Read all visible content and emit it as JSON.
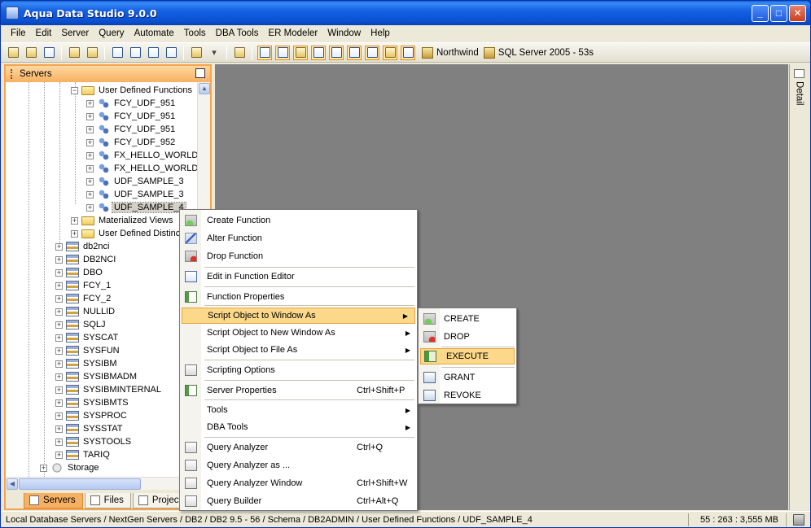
{
  "window": {
    "title": "Aqua Data Studio 9.0.0",
    "minimize": "_",
    "maximize": "□",
    "close": "✕"
  },
  "menubar": [
    "File",
    "Edit",
    "Server",
    "Query",
    "Automate",
    "Tools",
    "DBA Tools",
    "ER Modeler",
    "Window",
    "Help"
  ],
  "toolbar": {
    "connections": [
      "Northwind",
      "SQL Server 2005 - 53s"
    ]
  },
  "servers_panel": {
    "title": "Servers",
    "tree": [
      {
        "label": "User Defined Functions",
        "icon": "folder-icon",
        "expander": "−",
        "indent": 2
      },
      {
        "label": "FCY_UDF_951",
        "icon": "udf-icon",
        "expander": "+",
        "indent": 3
      },
      {
        "label": "FCY_UDF_951",
        "icon": "udf-icon",
        "expander": "+",
        "indent": 3
      },
      {
        "label": "FCY_UDF_951",
        "icon": "udf-icon",
        "expander": "+",
        "indent": 3
      },
      {
        "label": "FCY_UDF_952",
        "icon": "udf-icon",
        "expander": "+",
        "indent": 3
      },
      {
        "label": "FX_HELLO_WORLD_",
        "icon": "udf-icon",
        "expander": "+",
        "indent": 3
      },
      {
        "label": "FX_HELLO_WORLD_",
        "icon": "udf-icon",
        "expander": "+",
        "indent": 3
      },
      {
        "label": "UDF_SAMPLE_3",
        "icon": "udf-icon",
        "expander": "+",
        "indent": 3
      },
      {
        "label": "UDF_SAMPLE_3",
        "icon": "udf-icon",
        "expander": "+",
        "indent": 3
      },
      {
        "label": "UDF_SAMPLE_4",
        "icon": "udf-icon",
        "expander": "+",
        "indent": 3,
        "selected": true
      },
      {
        "label": "Materialized Views",
        "icon": "folder-icon",
        "expander": "+",
        "indent": 2
      },
      {
        "label": "User Defined Distinct Types",
        "icon": "folder-icon",
        "expander": "+",
        "indent": 2
      },
      {
        "label": "db2nci",
        "icon": "schema-icon",
        "expander": "+",
        "indent": 1
      },
      {
        "label": "DB2NCI",
        "icon": "schema-icon",
        "expander": "+",
        "indent": 1
      },
      {
        "label": "DBO",
        "icon": "schema-icon",
        "expander": "+",
        "indent": 1
      },
      {
        "label": "FCY_1",
        "icon": "schema-icon",
        "expander": "+",
        "indent": 1
      },
      {
        "label": "FCY_2",
        "icon": "schema-icon",
        "expander": "+",
        "indent": 1
      },
      {
        "label": "NULLID",
        "icon": "schema-icon",
        "expander": "+",
        "indent": 1
      },
      {
        "label": "SQLJ",
        "icon": "schema-icon",
        "expander": "+",
        "indent": 1
      },
      {
        "label": "SYSCAT",
        "icon": "schema-icon",
        "expander": "+",
        "indent": 1
      },
      {
        "label": "SYSFUN",
        "icon": "schema-icon",
        "expander": "+",
        "indent": 1
      },
      {
        "label": "SYSIBM",
        "icon": "schema-icon",
        "expander": "+",
        "indent": 1
      },
      {
        "label": "SYSIBMADM",
        "icon": "schema-icon",
        "expander": "+",
        "indent": 1
      },
      {
        "label": "SYSIBMINTERNAL",
        "icon": "schema-icon",
        "expander": "+",
        "indent": 1
      },
      {
        "label": "SYSIBMTS",
        "icon": "schema-icon",
        "expander": "+",
        "indent": 1
      },
      {
        "label": "SYSPROC",
        "icon": "schema-icon",
        "expander": "+",
        "indent": 1
      },
      {
        "label": "SYSSTAT",
        "icon": "schema-icon",
        "expander": "+",
        "indent": 1
      },
      {
        "label": "SYSTOOLS",
        "icon": "schema-icon",
        "expander": "+",
        "indent": 1
      },
      {
        "label": "TARIQ",
        "icon": "schema-icon",
        "expander": "+",
        "indent": 1
      },
      {
        "label": "Storage",
        "icon": "storage-icon",
        "expander": "+",
        "indent": 0
      }
    ],
    "tabs": [
      "Servers",
      "Files",
      "Projects"
    ]
  },
  "detail_strip": {
    "label": "Detail"
  },
  "context_menu": {
    "items": [
      {
        "label": "Create Function",
        "shortcut": "",
        "icon": "create-function-icon",
        "submenu": false
      },
      {
        "label": "Alter Function",
        "shortcut": "",
        "icon": "alter-function-icon",
        "submenu": false
      },
      {
        "label": "Drop Function",
        "shortcut": "",
        "icon": "drop-function-icon",
        "submenu": false
      },
      {
        "label": "Edit in Function Editor",
        "shortcut": "",
        "icon": "edit-icon",
        "submenu": false
      },
      {
        "label": "Function Properties",
        "shortcut": "",
        "icon": "properties-icon",
        "submenu": false
      },
      {
        "label": "Script Object to Window As",
        "shortcut": "",
        "icon": "",
        "submenu": true,
        "highlighted": true
      },
      {
        "label": "Script Object to New Window As",
        "shortcut": "",
        "icon": "",
        "submenu": true
      },
      {
        "label": "Script Object to File As",
        "shortcut": "",
        "icon": "",
        "submenu": true
      },
      {
        "label": "Scripting Options",
        "shortcut": "",
        "icon": "scripting-options-icon",
        "submenu": false
      },
      {
        "label": "Server Properties",
        "shortcut": "Ctrl+Shift+P",
        "icon": "server-properties-icon",
        "submenu": false
      },
      {
        "label": "Tools",
        "shortcut": "",
        "icon": "",
        "submenu": true
      },
      {
        "label": "DBA Tools",
        "shortcut": "",
        "icon": "",
        "submenu": true
      },
      {
        "label": "Query Analyzer",
        "shortcut": "Ctrl+Q",
        "icon": "query-analyzer-icon",
        "submenu": false
      },
      {
        "label": "Query Analyzer as ...",
        "shortcut": "",
        "icon": "query-analyzer-as-icon",
        "submenu": false
      },
      {
        "label": "Query Analyzer Window",
        "shortcut": "Ctrl+Shift+W",
        "icon": "query-analyzer-window-icon",
        "submenu": false
      },
      {
        "label": "Query Builder",
        "shortcut": "Ctrl+Alt+Q",
        "icon": "query-builder-icon",
        "submenu": false
      }
    ]
  },
  "submenu": {
    "items": [
      {
        "label": "CREATE",
        "icon": "create-icon"
      },
      {
        "label": "DROP",
        "icon": "drop-icon"
      },
      {
        "label": "EXECUTE",
        "icon": "execute-icon",
        "highlighted": true
      },
      {
        "label": "GRANT",
        "icon": "grant-icon"
      },
      {
        "label": "REVOKE",
        "icon": "revoke-icon"
      }
    ]
  },
  "statusbar": {
    "path": "Local Database Servers / NextGen Servers / DB2 / DB2 9.5 - 56 / Schema / DB2ADMIN / User Defined Functions / UDF_SAMPLE_4",
    "memory": "55 : 263 : 3,555 MB"
  },
  "colors": {
    "panel_border": "#f5a44d",
    "highlight": "#fbd88a",
    "workspace": "#808080",
    "titlebar": "#0a4fd0"
  }
}
